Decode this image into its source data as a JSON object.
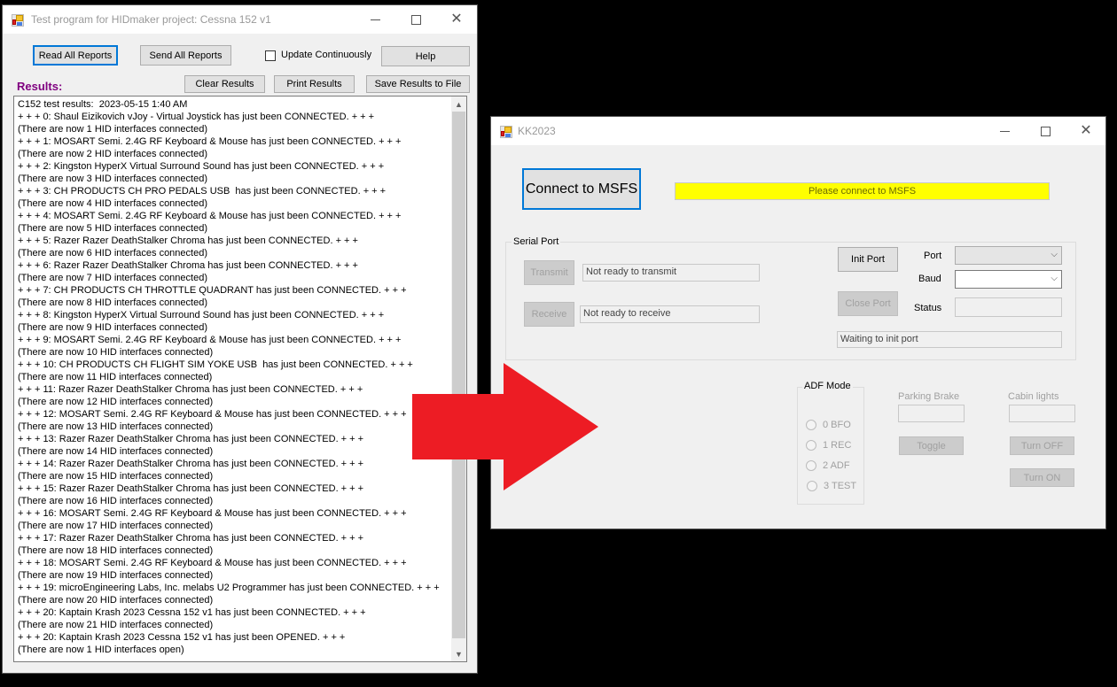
{
  "left_window": {
    "title": "Test program for HIDmaker project: Cessna 152 v1",
    "buttons": {
      "read_all": "Read All Reports",
      "send_all": "Send All Reports",
      "help": "Help",
      "clear": "Clear Results",
      "print": "Print Results",
      "save": "Save Results to File"
    },
    "update_continuously": {
      "label": "Update Continuously",
      "checked": false
    },
    "results_label": "Results:",
    "results_color": "#800080",
    "log": [
      "C152 test results:  2023-05-15 1:40 AM",
      "+ + + 0: Shaul Eizikovich vJoy - Virtual Joystick has just been CONNECTED. + + +",
      "(There are now 1 HID interfaces connected)",
      "+ + + 1: MOSART Semi. 2.4G RF Keyboard & Mouse has just been CONNECTED. + + +",
      "(There are now 2 HID interfaces connected)",
      "+ + + 2: Kingston HyperX Virtual Surround Sound has just been CONNECTED. + + +",
      "(There are now 3 HID interfaces connected)",
      "+ + + 3: CH PRODUCTS CH PRO PEDALS USB  has just been CONNECTED. + + +",
      "(There are now 4 HID interfaces connected)",
      "+ + + 4: MOSART Semi. 2.4G RF Keyboard & Mouse has just been CONNECTED. + + +",
      "(There are now 5 HID interfaces connected)",
      "+ + + 5: Razer Razer DeathStalker Chroma has just been CONNECTED. + + +",
      "(There are now 6 HID interfaces connected)",
      "+ + + 6: Razer Razer DeathStalker Chroma has just been CONNECTED. + + +",
      "(There are now 7 HID interfaces connected)",
      "+ + + 7: CH PRODUCTS CH THROTTLE QUADRANT has just been CONNECTED. + + +",
      "(There are now 8 HID interfaces connected)",
      "+ + + 8: Kingston HyperX Virtual Surround Sound has just been CONNECTED. + + +",
      "(There are now 9 HID interfaces connected)",
      "+ + + 9: MOSART Semi. 2.4G RF Keyboard & Mouse has just been CONNECTED. + + +",
      "(There are now 10 HID interfaces connected)",
      "+ + + 10: CH PRODUCTS CH FLIGHT SIM YOKE USB  has just been CONNECTED. + + +",
      "(There are now 11 HID interfaces connected)",
      "+ + + 11: Razer Razer DeathStalker Chroma has just been CONNECTED. + + +",
      "(There are now 12 HID interfaces connected)",
      "+ + + 12: MOSART Semi. 2.4G RF Keyboard & Mouse has just been CONNECTED. + + +",
      "(There are now 13 HID interfaces connected)",
      "+ + + 13: Razer Razer DeathStalker Chroma has just been CONNECTED. + + +",
      "(There are now 14 HID interfaces connected)",
      "+ + + 14: Razer Razer DeathStalker Chroma has just been CONNECTED. + + +",
      "(There are now 15 HID interfaces connected)",
      "+ + + 15: Razer Razer DeathStalker Chroma has just been CONNECTED. + + +",
      "(There are now 16 HID interfaces connected)",
      "+ + + 16: MOSART Semi. 2.4G RF Keyboard & Mouse has just been CONNECTED. + + +",
      "(There are now 17 HID interfaces connected)",
      "+ + + 17: Razer Razer DeathStalker Chroma has just been CONNECTED. + + +",
      "(There are now 18 HID interfaces connected)",
      "+ + + 18: MOSART Semi. 2.4G RF Keyboard & Mouse has just been CONNECTED. + + +",
      "(There are now 19 HID interfaces connected)",
      "+ + + 19: microEngineering Labs, Inc. melabs U2 Programmer has just been CONNECTED. + + +",
      "(There are now 20 HID interfaces connected)",
      "+ + + 20: Kaptain Krash 2023 Cessna 152 v1 has just been CONNECTED. + + +",
      "(There are now 21 HID interfaces connected)",
      "+ + + 20: Kaptain Krash 2023 Cessna 152 v1 has just been OPENED. + + +",
      "(There are now 1 HID interfaces open)"
    ]
  },
  "right_window": {
    "title": "KK2023",
    "connect_button": "Connect to MSFS",
    "connect_status": "Please connect to MSFS",
    "connect_status_color": "#ffff00",
    "serial_port": {
      "group_title": "Serial Port",
      "transmit_button": "Transmit",
      "transmit_status": "Not ready to transmit",
      "receive_button": "Receive",
      "receive_status": "Not ready to receive",
      "init_port_button": "Init Port",
      "close_port_button": "Close Port",
      "port_label": "Port",
      "port_value": "",
      "baud_label": "Baud",
      "baud_value": "",
      "status_label": "Status",
      "status_value": "",
      "port_status": "Waiting to init port"
    },
    "adf_mode": {
      "group_title": "ADF Mode",
      "options": [
        "0 BFO",
        "1 REC",
        "2 ADF",
        "3 TEST"
      ],
      "selected": null
    },
    "parking_brake": {
      "label": "Parking Brake",
      "value": "",
      "toggle_button": "Toggle"
    },
    "cabin_lights": {
      "label": "Cabin lights",
      "value": "",
      "off_button": "Turn OFF",
      "on_button": "Turn ON"
    }
  },
  "annotation": {
    "arrow_direction": "right",
    "arrow_color": "#ed1c24"
  }
}
